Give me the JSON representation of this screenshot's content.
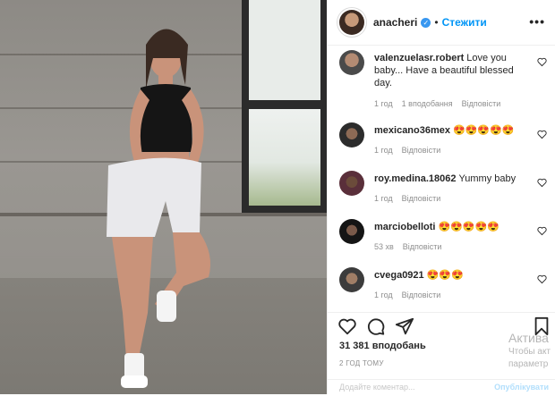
{
  "post": {
    "username": "anacheri",
    "follow_label": "Стежити",
    "separator": "•",
    "more_label": "•••",
    "likes": "31 381 вподобань",
    "time": "2 ГОД ТОМУ",
    "add_comment_placeholder": "Додайте коментар...",
    "post_label": "Опублікувати"
  },
  "comments": [
    {
      "user": "valenzuelasr.robert",
      "text": "Love you baby... Have a beautiful blessed day.",
      "time": "1 год",
      "likes": "1 вподобання",
      "reply": "Відповісти"
    },
    {
      "user": "mexicano36mex",
      "text": "😍😍😍😍😍",
      "time": "1 год",
      "likes": "",
      "reply": "Відповісти"
    },
    {
      "user": "roy.medina.18062",
      "text": "Yummy baby",
      "time": "1 год",
      "likes": "",
      "reply": "Відповісти"
    },
    {
      "user": "marciobelloti",
      "text": "😍😍😍😍😍",
      "time": "53 хв",
      "likes": "",
      "reply": "Відповісти"
    },
    {
      "user": "cvega0921",
      "text": "😍😍😍",
      "time": "1 год",
      "likes": "",
      "reply": "Відповісти"
    }
  ],
  "watermark": {
    "line1": "Актива",
    "line2": "Чтобы акт",
    "line3": "параметр"
  },
  "icons": [
    "verified-badge-icon",
    "heart-icon",
    "comment-icon",
    "share-icon",
    "bookmark-icon",
    "more-options-icon"
  ],
  "colors": {
    "accent": "#0095f6",
    "muted": "#8e8e8e",
    "border": "#efefef"
  }
}
